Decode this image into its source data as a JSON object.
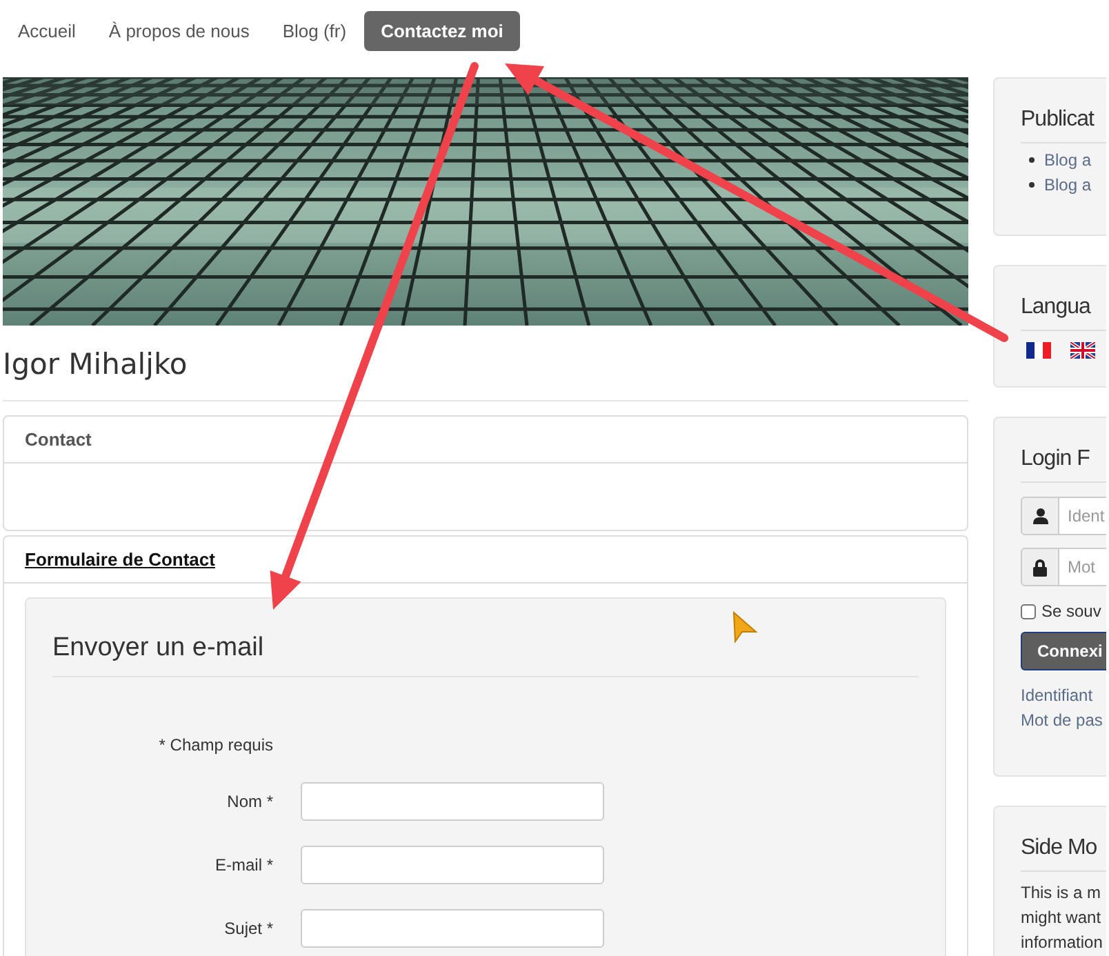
{
  "nav": {
    "items": [
      {
        "label": "Accueil",
        "selected": false
      },
      {
        "label": "À propos de nous",
        "selected": false
      },
      {
        "label": "Blog (fr)",
        "selected": false
      },
      {
        "label": "Contactez moi",
        "selected": true
      }
    ]
  },
  "page_title": "Igor Mihaljko",
  "panels": [
    {
      "title": "Contact",
      "kind": "plain"
    },
    {
      "title": "Formulaire de Contact",
      "kind": "link"
    }
  ],
  "form": {
    "heading": "Envoyer un e-mail",
    "required_note": "* Champ requis",
    "fields": [
      {
        "label": "Nom *"
      },
      {
        "label": "E-mail *"
      },
      {
        "label": "Sujet *"
      }
    ]
  },
  "sidebar": {
    "publications": {
      "title": "Publicat",
      "items": [
        "Blog a",
        "Blog a"
      ]
    },
    "languages": {
      "title": "Langua",
      "flags": [
        {
          "kind": "fr"
        },
        {
          "kind": "gb"
        }
      ]
    },
    "login": {
      "title": "Login F",
      "fields": [
        {
          "kind": "user",
          "placeholder": "Ident"
        },
        {
          "kind": "lock",
          "placeholder": "Mot"
        }
      ],
      "remember": {
        "label": "Se souv",
        "checked": false
      },
      "button": "Connexi",
      "links": [
        "Identifiant",
        "Mot de pas"
      ]
    },
    "side_module": {
      "title": "Side Mo",
      "lines": [
        "This is a m",
        "might want",
        "information"
      ]
    }
  }
}
